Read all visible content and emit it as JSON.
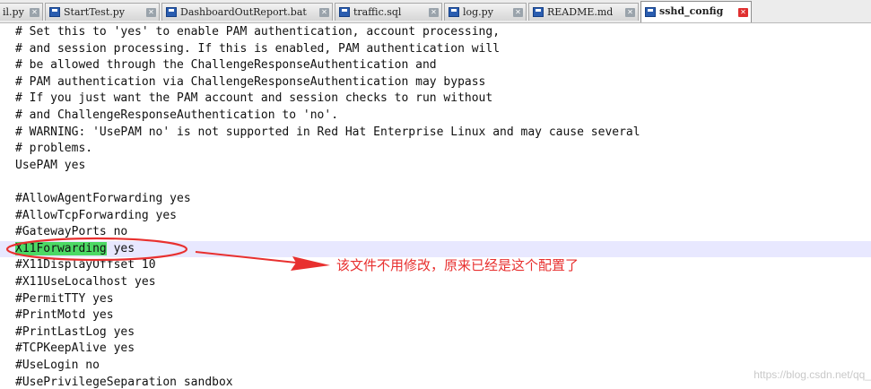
{
  "tabs": [
    {
      "label": "il.py",
      "active": false
    },
    {
      "label": "StartTest.py",
      "active": false
    },
    {
      "label": "DashboardOutReport.bat",
      "active": false
    },
    {
      "label": "traffic.sql",
      "active": false
    },
    {
      "label": "log.py",
      "active": false
    },
    {
      "label": "README.md",
      "active": false
    },
    {
      "label": "sshd_config",
      "active": true
    }
  ],
  "editor": {
    "lines": [
      "# Set this to 'yes' to enable PAM authentication, account processing,",
      "# and session processing. If this is enabled, PAM authentication will",
      "# be allowed through the ChallengeResponseAuthentication and",
      "# PAM authentication via ChallengeResponseAuthentication may bypass",
      "# If you just want the PAM account and session checks to run without",
      "# and ChallengeResponseAuthentication to 'no'.",
      "# WARNING: 'UsePAM no' is not supported in Red Hat Enterprise Linux and may cause several",
      "# problems.",
      "UsePAM yes",
      "",
      "#AllowAgentForwarding yes",
      "#AllowTcpForwarding yes",
      "#GatewayPorts no",
      "X11Forwarding yes",
      "#X11DisplayOffset 10",
      "#X11UseLocalhost yes",
      "#PermitTTY yes",
      "#PrintMotd yes",
      "#PrintLastLog yes",
      "#TCPKeepAlive yes",
      "#UseLogin no",
      "#UsePrivilegeSeparation sandbox"
    ],
    "current_line_index": 13,
    "highlight": {
      "line_index": 13,
      "text": "X11Forwarding"
    }
  },
  "annotation": {
    "text": "该文件不用修改，原来已经是这个配置了",
    "color": "#e8302f"
  },
  "watermark": "https://blog.csdn.net/qq_",
  "colors": {
    "current_line_bg": "#e8e8ff",
    "search_highlight": "#4cd964",
    "annotation_red": "#e8302f"
  }
}
